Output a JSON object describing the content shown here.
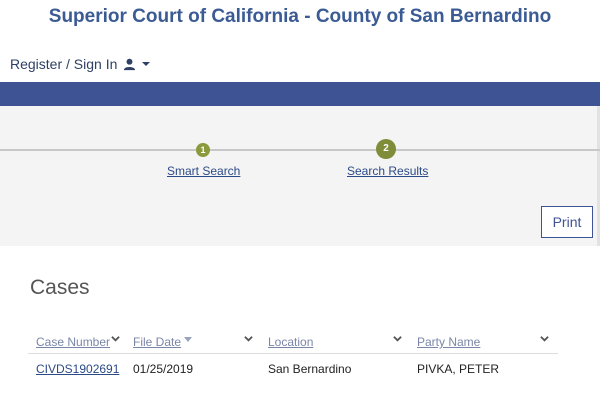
{
  "header": {
    "title": "Superior Court of California - County of San Bernardino",
    "signin_label": "Register / Sign In",
    "user_icon": "user-icon",
    "caret_icon": "caret-down-icon"
  },
  "wizard": {
    "steps": [
      {
        "number": "1",
        "label": "Smart Search"
      },
      {
        "number": "2",
        "label": "Search Results"
      }
    ],
    "print_label": "Print"
  },
  "cases": {
    "title": "Cases",
    "columns": [
      {
        "label": "Case Number"
      },
      {
        "label": "File Date"
      },
      {
        "label": "Location"
      },
      {
        "label": "Party Name"
      }
    ],
    "rows": [
      {
        "case_number": "CIVDS1902691",
        "file_date": "01/25/2019",
        "location": "San Bernardino",
        "party_name": "PIVKA, PETER"
      }
    ]
  },
  "colors": {
    "brand": "#3e5394",
    "title": "#3b5b94",
    "step": "#7f8c3a"
  }
}
